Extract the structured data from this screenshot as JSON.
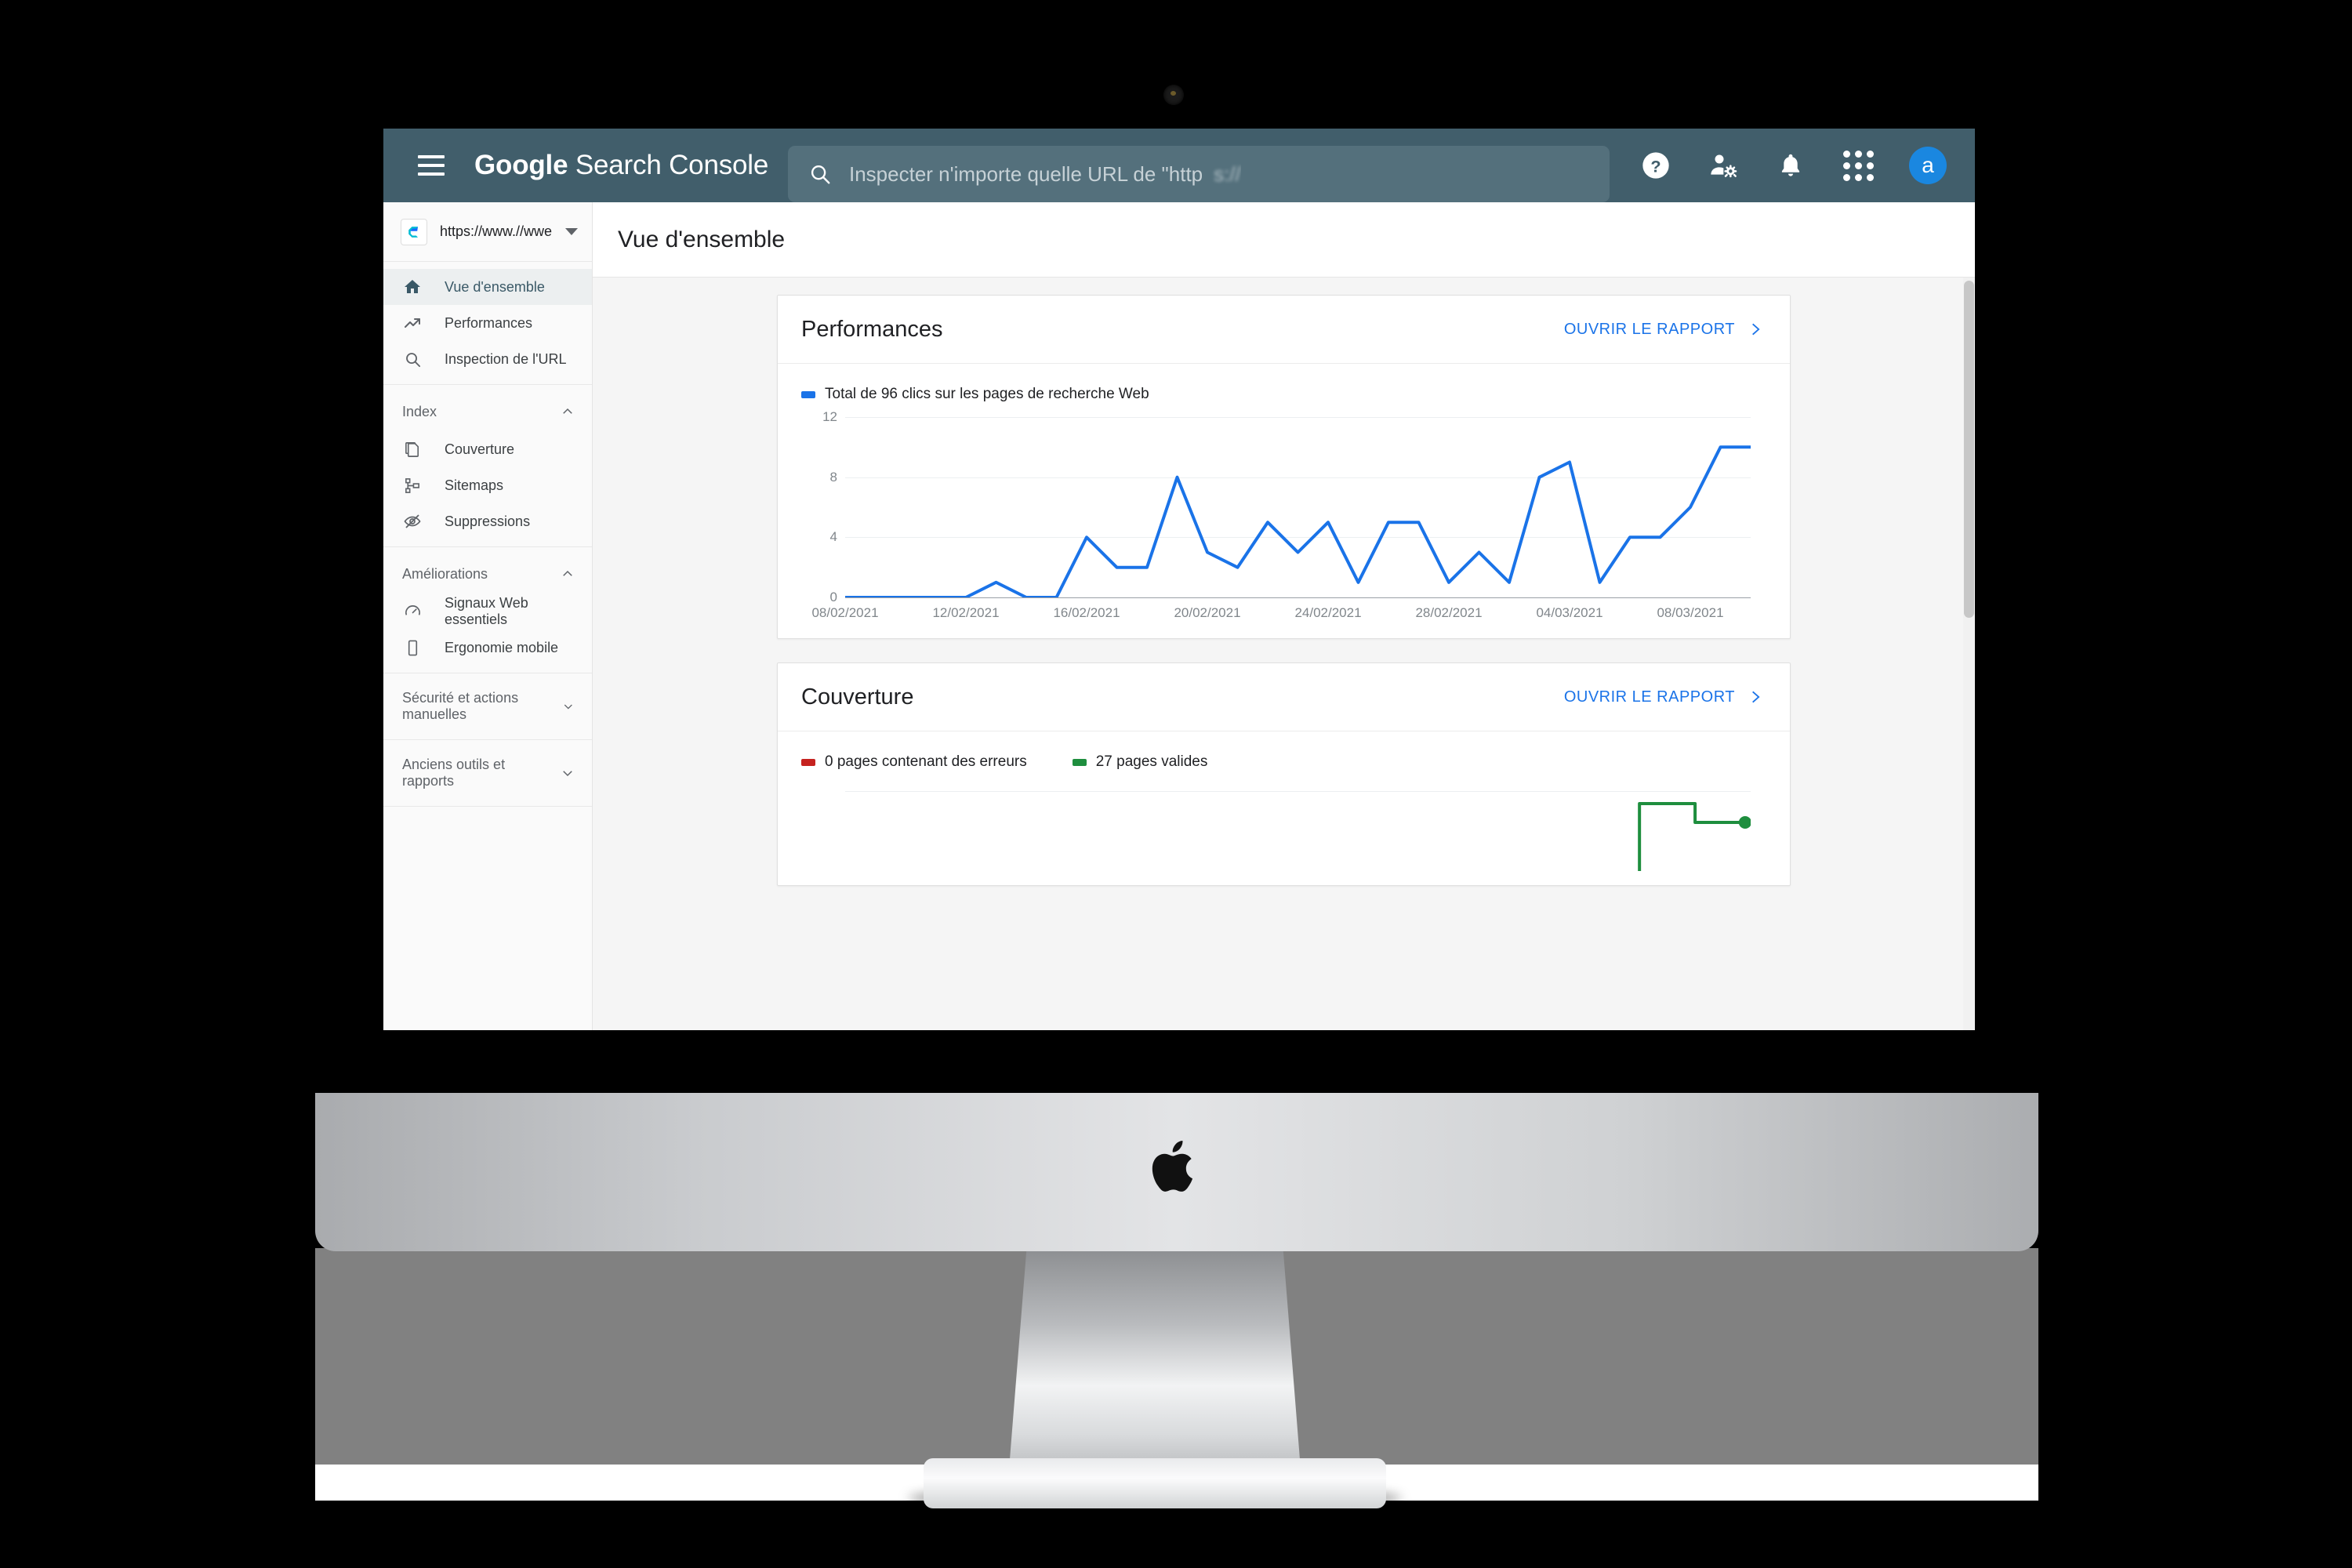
{
  "header": {
    "menu_icon": "hamburger-menu-icon",
    "brand_primary": "Google",
    "brand_secondary": " Search Console",
    "search": {
      "icon": "search-icon",
      "placeholder": "Inspecter n'importe quelle URL de \"http",
      "blurred_suffix": "s://"
    },
    "icons": [
      {
        "name": "help-icon",
        "label": "Aide"
      },
      {
        "name": "account-settings-icon",
        "label": "Paramètres du compte"
      },
      {
        "name": "notifications-bell-icon",
        "label": "Notifications"
      },
      {
        "name": "apps-grid-icon",
        "label": "Applications Google"
      }
    ],
    "avatar_initial": "a",
    "avatar_color": "#1a87e0",
    "bar_color": "#415e6b"
  },
  "sidebar": {
    "property": {
      "logo": "property-logo-icon",
      "url": "https://www.//wwe",
      "blurred_tail": "      ",
      "caret": "chevron-down-icon"
    },
    "main_items": [
      {
        "label": "Vue d'ensemble",
        "icon": "home-icon",
        "active": true
      },
      {
        "label": "Performances",
        "icon": "trending-up-icon",
        "active": false
      },
      {
        "label": "Inspection de l'URL",
        "icon": "search-icon",
        "active": false
      }
    ],
    "groups": [
      {
        "title": "Index",
        "expanded": true,
        "chevron": "chevron-up-icon",
        "items": [
          {
            "label": "Couverture",
            "icon": "pages-copy-icon"
          },
          {
            "label": "Sitemaps",
            "icon": "sitemap-tree-icon"
          },
          {
            "label": "Suppressions",
            "icon": "eye-off-icon"
          }
        ]
      },
      {
        "title": "Améliorations",
        "expanded": true,
        "chevron": "chevron-up-icon",
        "items": [
          {
            "label": "Signaux Web essentiels",
            "icon": "speedometer-icon"
          },
          {
            "label": "Ergonomie mobile",
            "icon": "mobile-phone-icon"
          }
        ]
      },
      {
        "title": "Sécurité et actions manuelles",
        "expanded": false,
        "chevron": "chevron-down-icon",
        "items": []
      },
      {
        "title": "Anciens outils et rapports",
        "expanded": false,
        "chevron": "chevron-down-icon",
        "items": []
      }
    ]
  },
  "page": {
    "title": "Vue d'ensemble"
  },
  "cards": {
    "performance": {
      "title": "Performances",
      "link": "OUVRIR LE RAPPORT",
      "link_icon": "chevron-right-icon",
      "legend_label": "Total de 96 clics sur les pages de recherche Web",
      "legend_color": "#1a73e8"
    },
    "coverage": {
      "title": "Couverture",
      "link": "OUVRIR LE RAPPORT",
      "link_icon": "chevron-right-icon",
      "legend": [
        {
          "label": "0 pages contenant des erreurs",
          "color": "#c5221f"
        },
        {
          "label": "27 pages valides",
          "color": "#1e8e3e"
        }
      ]
    }
  },
  "chart_data": [
    {
      "type": "line",
      "title": "Total de 96 clics sur les pages de recherche Web",
      "xlabel": "",
      "ylabel": "",
      "ylim": [
        0,
        12
      ],
      "yticks": [
        0,
        4,
        8,
        12
      ],
      "grid": true,
      "legend_position": "top-left",
      "line_color": "#1a73e8",
      "xticks": [
        "08/02/2021",
        "12/02/2021",
        "16/02/2021",
        "20/02/2021",
        "24/02/2021",
        "28/02/2021",
        "04/03/2021",
        "08/03/2021"
      ],
      "x": [
        "08/02/2021",
        "09/02/2021",
        "10/02/2021",
        "11/02/2021",
        "12/02/2021",
        "13/02/2021",
        "14/02/2021",
        "15/02/2021",
        "16/02/2021",
        "17/02/2021",
        "18/02/2021",
        "19/02/2021",
        "20/02/2021",
        "21/02/2021",
        "22/02/2021",
        "23/02/2021",
        "24/02/2021",
        "25/02/2021",
        "26/02/2021",
        "27/02/2021",
        "28/02/2021",
        "01/03/2021",
        "02/03/2021",
        "03/03/2021",
        "04/03/2021",
        "05/03/2021",
        "06/03/2021",
        "07/03/2021",
        "08/03/2021",
        "09/03/2021",
        "10/03/2021"
      ],
      "values": [
        0,
        0,
        0,
        0,
        0,
        1,
        0,
        0,
        4,
        2,
        2,
        8,
        3,
        2,
        5,
        3,
        5,
        1,
        5,
        5,
        1,
        3,
        1,
        8,
        9,
        1,
        4,
        4,
        6,
        10,
        10
      ]
    },
    {
      "type": "line",
      "title": "Couverture",
      "ylim": [
        0,
        30
      ],
      "yticks": [
        30
      ],
      "grid": true,
      "legend_position": "top-left",
      "series": [
        {
          "name": "0 pages contenant des erreurs",
          "color": "#c5221f",
          "values": [
            0,
            0,
            0,
            0,
            0,
            0,
            0,
            0,
            0,
            0
          ]
        },
        {
          "name": "27 pages valides",
          "color": "#1e8e3e",
          "values": [
            0,
            0,
            0,
            0,
            0,
            0,
            0,
            29,
            29,
            27
          ]
        }
      ]
    }
  ],
  "device": {
    "brand_logo": "apple-logo-icon",
    "camera": "webcam-icon"
  }
}
